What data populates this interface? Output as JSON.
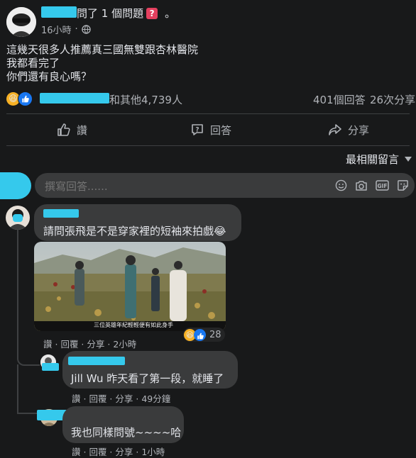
{
  "post": {
    "author_suffix": "問了 1 個問題",
    "time": "16小時",
    "lines": [
      "這幾天很多人推薦真三國無雙跟杏林醫院",
      "我都看完了",
      "你們還有良心嗎？"
    ],
    "reactions_suffix": "和其他4,739人",
    "answers_count": "401個回答",
    "shares_count": "26次分享"
  },
  "actions": {
    "like": "讚",
    "answer": "回答",
    "share": "分享"
  },
  "sort_label": "最相關留言",
  "composer": {
    "placeholder": "撰寫回答......"
  },
  "comments": [
    {
      "text": "請問張飛是不是穿家裡的短袖來拍戲😂",
      "image_caption": "三位英雄年紀輕輕便有如此身手",
      "reaction_count": "28",
      "like": "讚",
      "reply": "回覆",
      "share": "分享",
      "time": "2小時"
    },
    {
      "text": "Jill Wu 昨天看了第一段，就睡了",
      "like": "讚",
      "reply": "回覆",
      "share": "分享",
      "time": "49分鐘"
    },
    {
      "text": "我也同樣問號~~~~哈",
      "like": "讚",
      "reply": "回覆",
      "share": "分享",
      "time": "1小時"
    }
  ],
  "icons": {
    "globe": "globe-icon",
    "like": "thumbs-up-icon",
    "answer": "question-bubble-icon",
    "share": "share-arrow-icon",
    "emoji": "emoji-icon",
    "camera": "camera-icon",
    "gif": "gif-icon",
    "sticker": "sticker-icon"
  },
  "colors": {
    "background": "#18191a",
    "bubble": "#3a3b3c",
    "redaction": "#35c9ec",
    "like_blue": "#1877f2",
    "question_red": "#e4405f"
  }
}
